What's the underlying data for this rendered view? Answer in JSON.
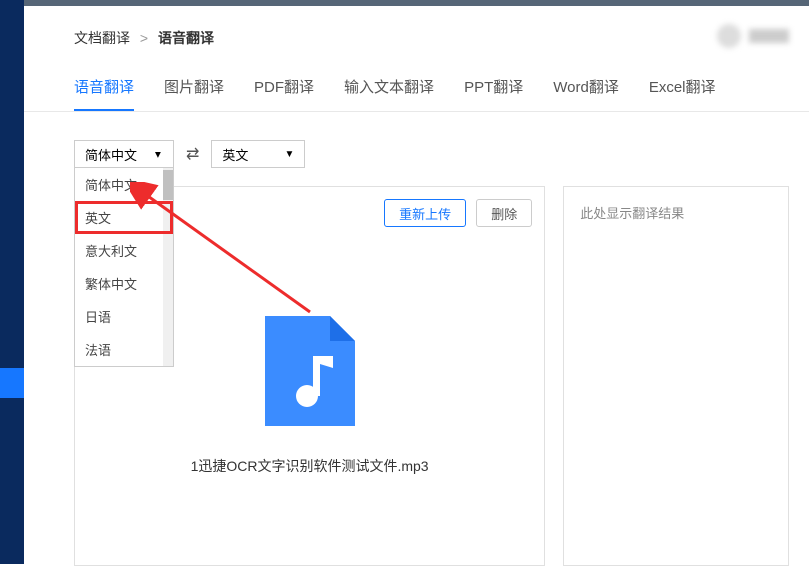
{
  "breadcrumb": {
    "parent": "文档翻译",
    "current": "语音翻译"
  },
  "tabs": {
    "items": [
      {
        "label": "语音翻译"
      },
      {
        "label": "图片翻译"
      },
      {
        "label": "PDF翻译"
      },
      {
        "label": "输入文本翻译"
      },
      {
        "label": "PPT翻译"
      },
      {
        "label": "Word翻译"
      },
      {
        "label": "Excel翻译"
      }
    ]
  },
  "source_lang": {
    "selected": "简体中文",
    "options": [
      {
        "label": "简体中文"
      },
      {
        "label": "英文"
      },
      {
        "label": "意大利文"
      },
      {
        "label": "繁体中文"
      },
      {
        "label": "日语"
      },
      {
        "label": "法语"
      }
    ]
  },
  "target_lang": {
    "selected": "英文"
  },
  "actions": {
    "reupload": "重新上传",
    "delete": "删除"
  },
  "result_hint": "此处显示翻译结果",
  "file": {
    "name": "1迅捷OCR文字识别软件测试文件.mp3"
  }
}
